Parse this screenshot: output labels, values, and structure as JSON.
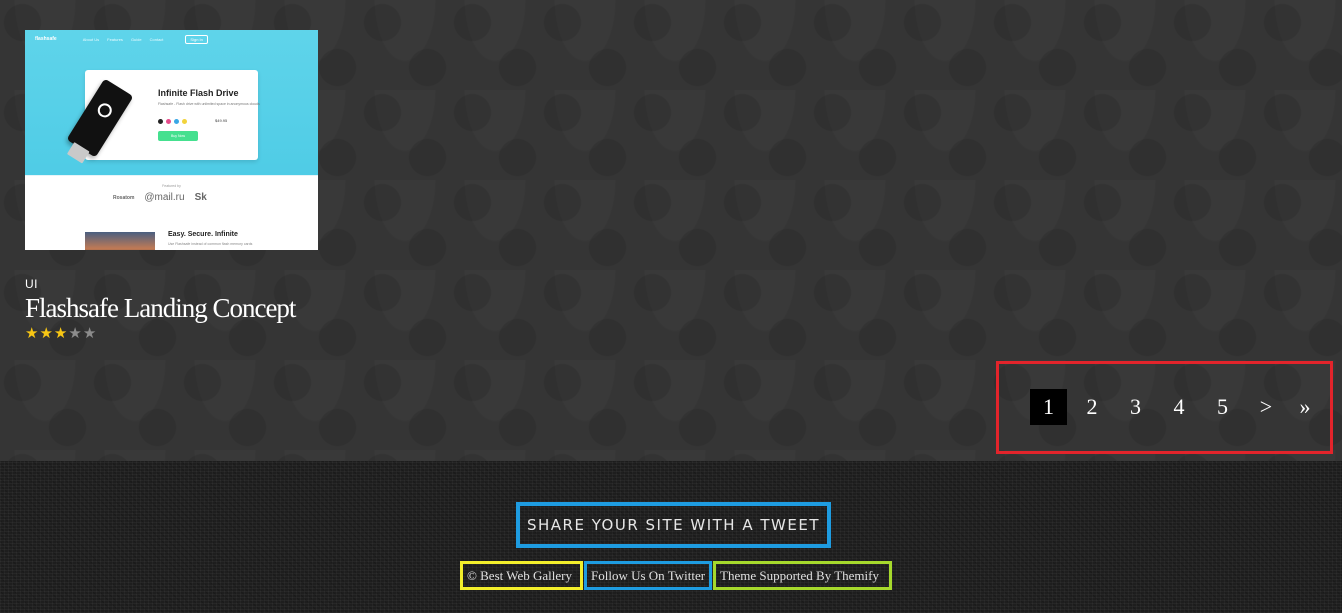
{
  "gallery": {
    "items": [
      {
        "category": "UI",
        "title": "Flashsafe Landing Concept",
        "rating": 3,
        "rating_max": 5,
        "thumbnail": {
          "logo": "flashsafe",
          "nav_items": [
            "About Us",
            "Features",
            "Guide",
            "Contact"
          ],
          "signin": "Sign In",
          "product_title": "Infinite Flash Drive",
          "product_desc": "Flashsafe - Flash drive with unlimited space in anonymous clouds",
          "price": "$49.95",
          "buy_label": "Buy Now",
          "featured_label": "Featured by",
          "partners": [
            "Rosatom",
            "@mail.ru",
            "Sk"
          ],
          "section_title": "Easy. Secure. Infinite",
          "section_desc": "Use Flashsafe instead of common flash memory cards",
          "swatch_colors": [
            "#222222",
            "#e74c8b",
            "#3aa7e6",
            "#f2d33b"
          ],
          "accent_color": "#4fcce6"
        }
      }
    ]
  },
  "pagination": {
    "pages": [
      "1",
      "2",
      "3",
      "4",
      "5"
    ],
    "active_page": "1",
    "next_label": ">",
    "last_label": "»"
  },
  "footer": {
    "tweet_label": "SHARE YOUR SITE WITH A TWEET",
    "links": {
      "copyright": "© Best Web Gallery",
      "twitter": "Follow Us On Twitter",
      "theme": "Theme Supported By Themify"
    }
  },
  "colors": {
    "page_background": "#353535",
    "footer_background": "#1e1e1e",
    "star_on": "#f7c614",
    "star_off": "#8c8c8c",
    "highlight_red": "#e3242b",
    "highlight_blue": "#1e9ce1",
    "highlight_yellow": "#f2ee2b",
    "highlight_green": "#a6d92c"
  }
}
